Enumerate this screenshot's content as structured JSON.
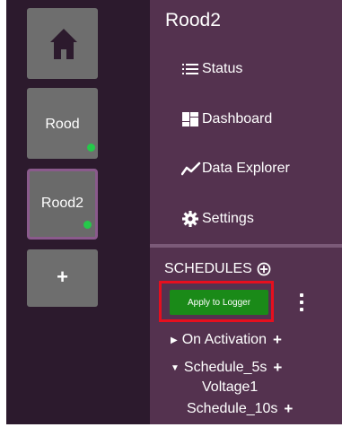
{
  "colors": {
    "rail_bg": "#2c1a2d",
    "panel_bg": "#54324f",
    "tile_bg": "#6e6e6e",
    "selected_border": "#8a5a8c",
    "online_dot": "#25c94a",
    "apply_button": "#1a8a18",
    "highlight_box": "#e60f1e"
  },
  "left_rail": {
    "home_icon": "home-icon",
    "loggers": [
      {
        "label": "Rood",
        "status": "online"
      },
      {
        "label": "Rood2",
        "status": "online",
        "selected": true
      }
    ],
    "add_label": "+"
  },
  "panel": {
    "title": "Rood2",
    "nav": [
      {
        "label": "Status",
        "icon": "list-icon"
      },
      {
        "label": "Dashboard",
        "icon": "dashboard-icon"
      },
      {
        "label": "Data Explorer",
        "icon": "trend-line-icon"
      },
      {
        "label": "Settings",
        "icon": "gear-icon"
      }
    ],
    "schedules": {
      "header": "SCHEDULES",
      "apply_button": "Apply to Logger",
      "items": [
        {
          "label": "On Activation",
          "expanded": false
        },
        {
          "label": "Schedule_5s",
          "expanded": true,
          "children": [
            "Voltage1"
          ]
        },
        {
          "label": "Schedule_10s"
        }
      ]
    }
  }
}
